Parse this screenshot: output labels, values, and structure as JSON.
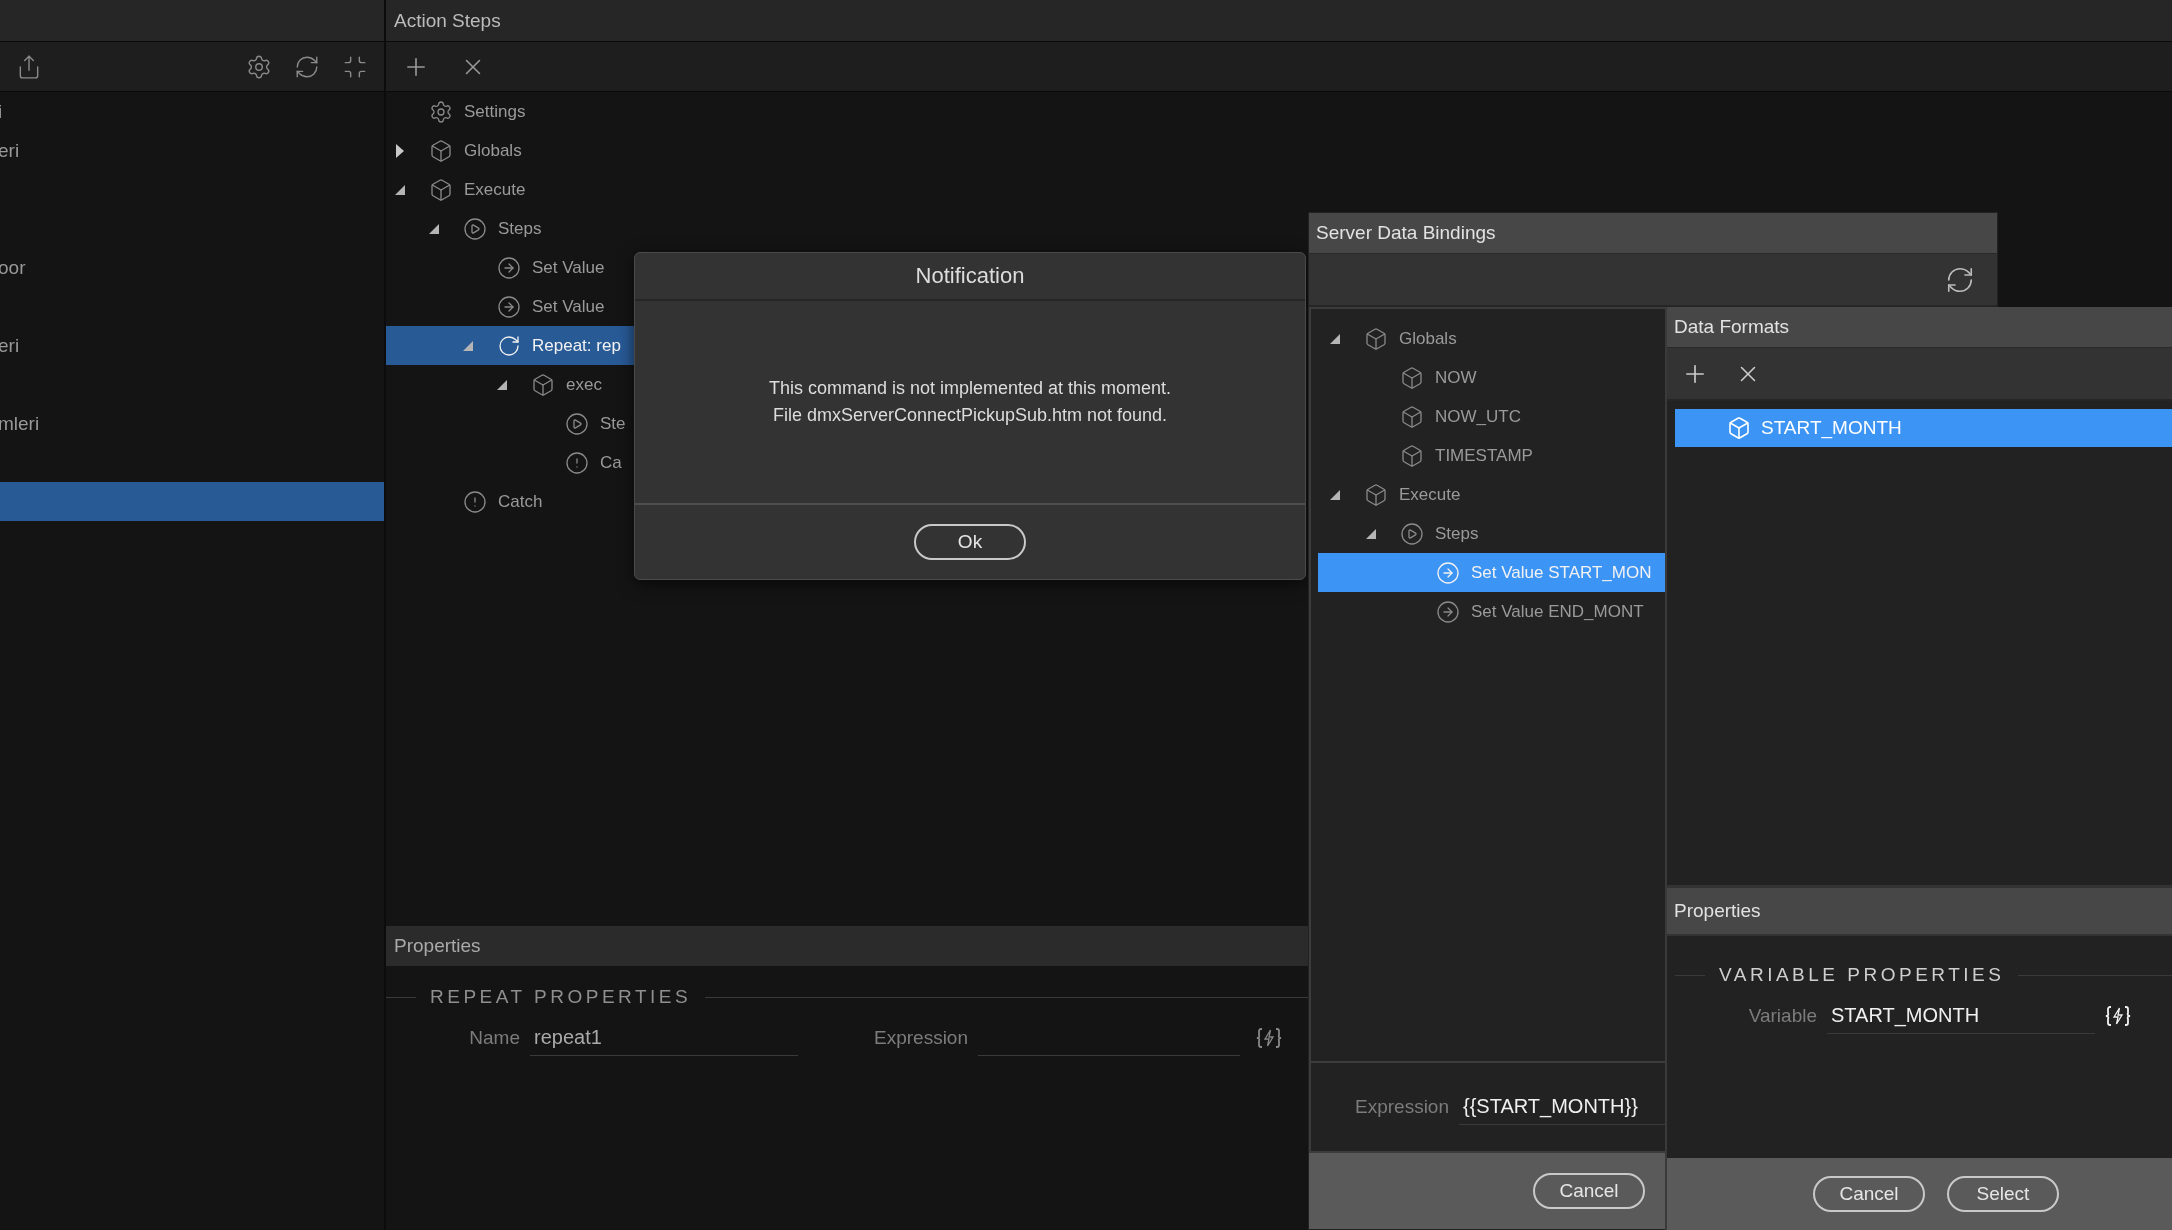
{
  "left_panel": {
    "items": [
      {
        "label": "i",
        "selected": false
      },
      {
        "label": "eri",
        "selected": false
      },
      {
        "label": "oor",
        "selected": false
      },
      {
        "label": "eri",
        "selected": false
      },
      {
        "label": "mleri",
        "selected": false
      },
      {
        "selected": true
      }
    ]
  },
  "action_steps": {
    "title": "Action Steps",
    "tree": [
      {
        "label": "Settings",
        "kind": "gear",
        "selected": false
      },
      {
        "label": "Globals",
        "kind": "cube",
        "expanded": false,
        "selected": false
      },
      {
        "label": "Execute",
        "kind": "cube",
        "expanded": true,
        "selected": false,
        "children": [
          {
            "label": "Steps",
            "kind": "play",
            "expanded": true,
            "selected": false,
            "children": [
              {
                "label": "Set Value",
                "kind": "arrow",
                "selected": false
              },
              {
                "label": "Set Value",
                "kind": "arrow",
                "selected": false
              },
              {
                "label": "Repeat: rep",
                "kind": "repeat",
                "expanded": true,
                "selected": true,
                "children": [
                  {
                    "label": "exec",
                    "kind": "cube",
                    "expanded": true,
                    "selected": false,
                    "children": [
                      {
                        "label": "Ste",
                        "kind": "play",
                        "selected": false
                      },
                      {
                        "label": "Ca",
                        "kind": "alert",
                        "selected": false
                      }
                    ]
                  }
                ]
              }
            ]
          },
          {
            "label": "Catch",
            "kind": "alert",
            "selected": false
          }
        ]
      }
    ]
  },
  "properties": {
    "title": "Properties",
    "section": "REPEAT PROPERTIES",
    "fields": [
      {
        "label": "Name",
        "value": "repeat1"
      },
      {
        "label": "Expression"
      }
    ]
  },
  "notification": {
    "title": "Notification",
    "lines": [
      "This command is not implemented at this moment.",
      "File dmxServerConnectPickupSub.htm not found."
    ],
    "button": "Ok"
  },
  "server_data_bindings": {
    "title": "Server Data Bindings",
    "tree": [
      {
        "label": "Globals",
        "kind": "cube",
        "expanded": true,
        "selected": false,
        "children": [
          {
            "label": "NOW",
            "kind": "cube",
            "selected": false
          },
          {
            "label": "NOW_UTC",
            "kind": "cube",
            "selected": false
          },
          {
            "label": "TIMESTAMP",
            "kind": "cube",
            "selected": false
          }
        ]
      },
      {
        "label": "Execute",
        "kind": "cube",
        "expanded": true,
        "selected": false,
        "children": [
          {
            "label": "Steps",
            "kind": "play",
            "expanded": true,
            "selected": false,
            "children": [
              {
                "label": "Set Value START_MON",
                "kind": "arrow",
                "selected": true
              },
              {
                "label": "Set Value END_MONT",
                "kind": "arrow",
                "selected": false
              }
            ]
          }
        ]
      }
    ],
    "expression": {
      "label": "Expression",
      "value": "{{START_MONTH}}"
    },
    "buttons": [
      "Cancel"
    ]
  },
  "data_formats": {
    "title": "Data Formats",
    "items": [
      {
        "label": "START_MONTH",
        "selected": true
      }
    ],
    "properties": {
      "title": "Properties",
      "section": "VARIABLE PROPERTIES",
      "fields": [
        {
          "label": "Variable",
          "value": "START_MONTH"
        }
      ]
    },
    "buttons": [
      "Cancel",
      "Select"
    ]
  }
}
